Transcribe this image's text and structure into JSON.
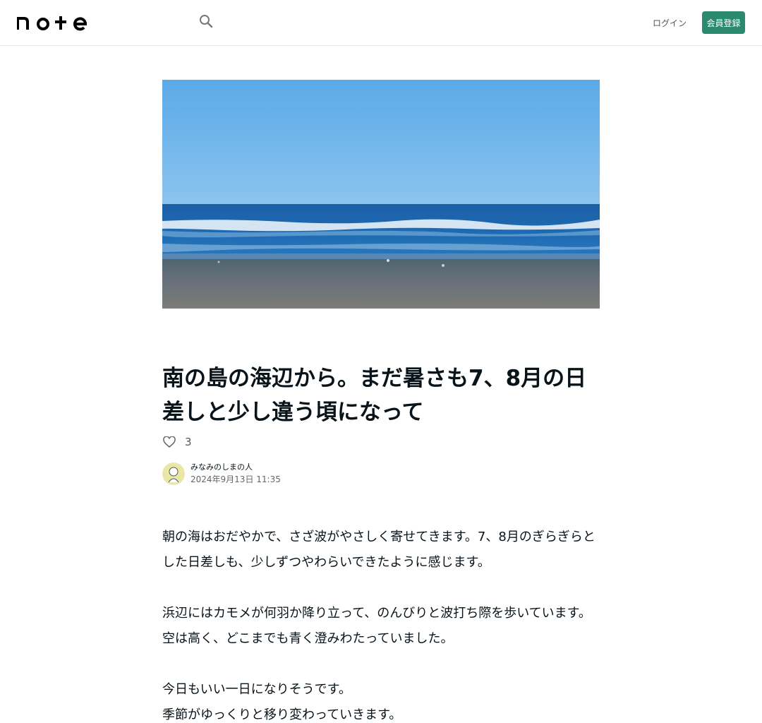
{
  "header": {
    "logo_text": "note",
    "login_label": "ログイン",
    "signup_label": "会員登録"
  },
  "article": {
    "title": "南の島の海辺から。まだ暑さも7、8月の日差しと少し違う頃になって",
    "like_count": "3",
    "author_name": "みなみのしまの人",
    "date": "2024年9月13日 11:35",
    "paragraphs": [
      "朝の海はおだやかで、さざ波がやさしく寄せてきます。7、8月のぎらぎらとした日差しも、少しずつやわらいできたように感じます。",
      "浜辺にはカモメが何羽か降り立って、のんびりと波打ち際を歩いています。空は高く、どこまでも青く澄みわたっていました。",
      "今日もいい一日になりそうです。",
      "季節がゆっくりと移り変わっていきます。"
    ]
  },
  "colors": {
    "brand_green": "#2b8a6e",
    "text": "#08131a",
    "border": "#e6e6e6"
  },
  "icons": {
    "search": "search-icon",
    "like": "heart-icon"
  }
}
